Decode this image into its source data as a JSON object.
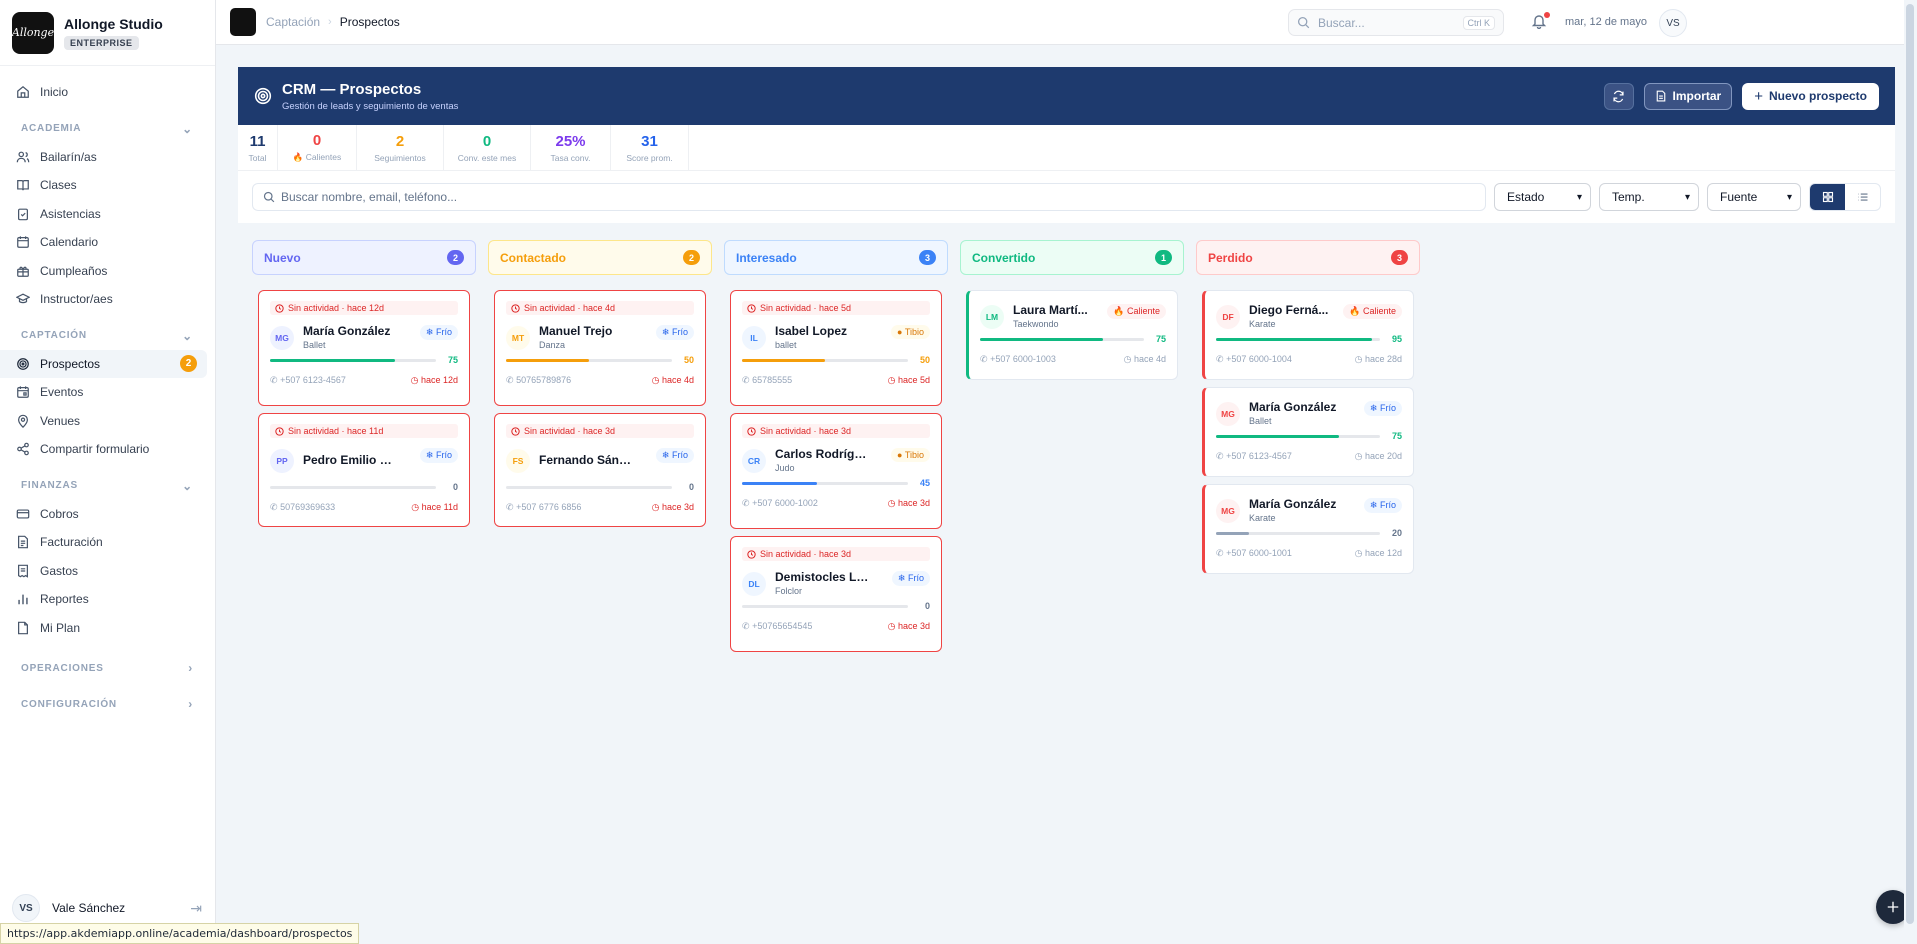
{
  "brand": {
    "name": "Allonge Studio",
    "plan": "ENTERPRISE",
    "logo_text": "Allonge"
  },
  "nav": {
    "inicio": "Inicio",
    "sections": {
      "academia": "ACADEMIA",
      "captacion": "CAPTACIÓN",
      "finanzas": "FINANZAS",
      "operaciones": "OPERACIONES",
      "configuracion": "CONFIGURACIÓN"
    },
    "academia": [
      "Bailarín/as",
      "Clases",
      "Asistencias",
      "Calendario",
      "Cumpleaños",
      "Instructor/aes"
    ],
    "captacion": [
      "Prospectos",
      "Eventos",
      "Venues",
      "Compartir formulario"
    ],
    "prospectos_count": "2",
    "finanzas": [
      "Cobros",
      "Facturación",
      "Gastos",
      "Reportes",
      "Mi Plan"
    ]
  },
  "user": {
    "initials": "VS",
    "name": "Vale Sánchez"
  },
  "status_url": "https://app.akdemiapp.online/academia/dashboard/prospectos",
  "topbar": {
    "breadcrumb": [
      "Captación",
      "Prospectos"
    ],
    "search_placeholder": "Buscar...",
    "search_shortcut": "Ctrl K",
    "date": "mar, 12 de mayo",
    "avatar": "VS"
  },
  "header": {
    "title": "CRM — Prospectos",
    "subtitle": "Gestión de leads y seguimiento de ventas",
    "import_label": "Importar",
    "new_label": "Nuevo prospecto"
  },
  "stats": [
    {
      "value": "11",
      "label": "Total",
      "color": "#1e3a6e"
    },
    {
      "value": "0",
      "label": "Calientes",
      "color": "#ef4444"
    },
    {
      "value": "2",
      "label": "Seguimientos",
      "color": "#f59e0b"
    },
    {
      "value": "0",
      "label": "Conv. este mes",
      "color": "#10b981"
    },
    {
      "value": "25%",
      "label": "Tasa conv.",
      "color": "#7c3aed"
    },
    {
      "value": "31",
      "label": "Score prom.",
      "color": "#2563eb"
    }
  ],
  "filters": {
    "search_placeholder": "Buscar nombre, email, teléfono...",
    "estado": "Estado",
    "temp": "Temp.",
    "fuente": "Fuente"
  },
  "columns": [
    {
      "name": "Nuevo",
      "count": "2",
      "color": "#6366f1",
      "bg": "#eef2ff",
      "border": "#c7d2fe",
      "cards": [
        {
          "warning": "Sin actividad · hace 12d",
          "initials": "MG",
          "name": "María González",
          "discipline": "Ballet",
          "tag": "Frío",
          "tag_type": "frio",
          "score": 75,
          "score_label": "75",
          "phone": "+507 6123-4567",
          "ago": "hace 12d"
        },
        {
          "warning": "Sin actividad · hace 11d",
          "initials": "PP",
          "name": "Pedro Emilio Pe...",
          "discipline": "",
          "tag": "Frío",
          "tag_type": "frio",
          "score": 0,
          "score_label": "0",
          "phone": "50769369633",
          "ago": "hace 11d"
        }
      ]
    },
    {
      "name": "Contactado",
      "count": "2",
      "color": "#f59e0b",
      "bg": "#fffbeb",
      "border": "#fde68a",
      "cards": [
        {
          "warning": "Sin actividad · hace 4d",
          "initials": "MT",
          "name": "Manuel Trejo",
          "discipline": "Danza",
          "tag": "Frío",
          "tag_type": "frio",
          "score": 50,
          "score_label": "50",
          "phone": "50765789876",
          "ago": "hace 4d"
        },
        {
          "warning": "Sin actividad · hace 3d",
          "initials": "FS",
          "name": "Fernando Sánchez",
          "discipline": "",
          "tag": "Frío",
          "tag_type": "frio",
          "score": 0,
          "score_label": "0",
          "phone": "+507 6776 6856",
          "ago": "hace 3d"
        }
      ]
    },
    {
      "name": "Interesado",
      "count": "3",
      "color": "#3b82f6",
      "bg": "#eff6ff",
      "border": "#bfdbfe",
      "cards": [
        {
          "warning": "Sin actividad · hace 5d",
          "initials": "IL",
          "name": "Isabel Lopez",
          "discipline": "ballet",
          "tag": "Tibio",
          "tag_type": "tibio",
          "score": 50,
          "score_label": "50",
          "phone": "65785555",
          "ago": "hace 5d"
        },
        {
          "warning": "Sin actividad · hace 3d",
          "initials": "CR",
          "name": "Carlos Rodríguez",
          "discipline": "Judo",
          "tag": "Tibio",
          "tag_type": "tibio",
          "score": 45,
          "score_label": "45",
          "phone": "+507 6000-1002",
          "ago": "hace 3d"
        },
        {
          "warning": "Sin actividad · hace 3d",
          "initials": "DL",
          "name": "Demistocles Lie...",
          "discipline": "Folclor",
          "tag": "Frío",
          "tag_type": "frio",
          "score": 0,
          "score_label": "0",
          "phone": "+50765654545",
          "ago": "hace 3d"
        }
      ]
    },
    {
      "name": "Convertido",
      "count": "1",
      "color": "#10b981",
      "bg": "#ecfdf5",
      "border": "#a7f3d0",
      "cards": [
        {
          "warning": "",
          "initials": "LM",
          "name": "Laura Martí...",
          "discipline": "Taekwondo",
          "tag": "Caliente",
          "tag_type": "cal",
          "score": 75,
          "score_label": "75",
          "phone": "+507 6000-1003",
          "ago": "hace 4d"
        }
      ]
    },
    {
      "name": "Perdido",
      "count": "3",
      "color": "#ef4444",
      "bg": "#fef2f2",
      "border": "#fecaca",
      "cards": [
        {
          "warning": "",
          "initials": "DF",
          "name": "Diego Ferná...",
          "discipline": "Karate",
          "tag": "Caliente",
          "tag_type": "cal",
          "score": 95,
          "score_label": "95",
          "phone": "+507 6000-1004",
          "ago": "hace 28d"
        },
        {
          "warning": "",
          "initials": "MG",
          "name": "María González",
          "discipline": "Ballet",
          "tag": "Frío",
          "tag_type": "frio",
          "score": 75,
          "score_label": "75",
          "phone": "+507 6123-4567",
          "ago": "hace 20d"
        },
        {
          "warning": "",
          "initials": "MG",
          "name": "María González",
          "discipline": "Karate",
          "tag": "Frío",
          "tag_type": "frio",
          "score": 20,
          "score_label": "20",
          "phone": "+507 6000-1001",
          "ago": "hace 12d"
        }
      ]
    }
  ]
}
